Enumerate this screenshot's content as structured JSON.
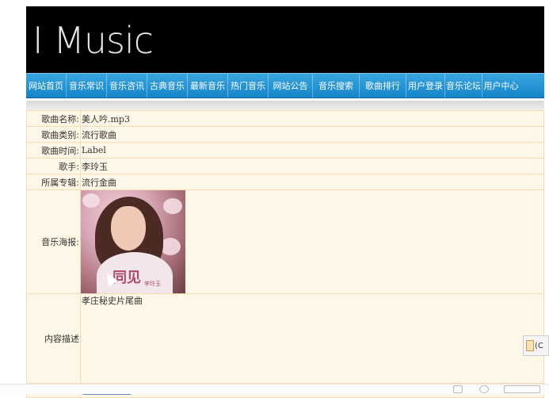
{
  "site": {
    "logo": "I Music"
  },
  "nav": [
    "网站首页",
    "音乐常识",
    "音乐咨讯",
    "古典音乐",
    "最新音乐",
    "热门音乐",
    "网站公告",
    "音乐搜索",
    "歌曲排行",
    "用户登录",
    "音乐论坛",
    "用户中心"
  ],
  "detail": {
    "name_label": "歌曲名称:",
    "name_value": "美人吟.mp3",
    "type_label": "歌曲类别:",
    "type_value": "流行歌曲",
    "time_label": "歌曲时间:",
    "time_value": "Label",
    "singer_label": "歌手:",
    "singer_value": "李玲玉",
    "album_label": "所属专辑:",
    "album_value": "流行金曲",
    "poster_label": "音乐海报:",
    "poster_title": "同见",
    "poster_artist": "李玲玉",
    "desc_label": "内容描述",
    "desc_value": "孝庄秘史片尾曲"
  },
  "clipboard": {
    "label": "(C"
  }
}
